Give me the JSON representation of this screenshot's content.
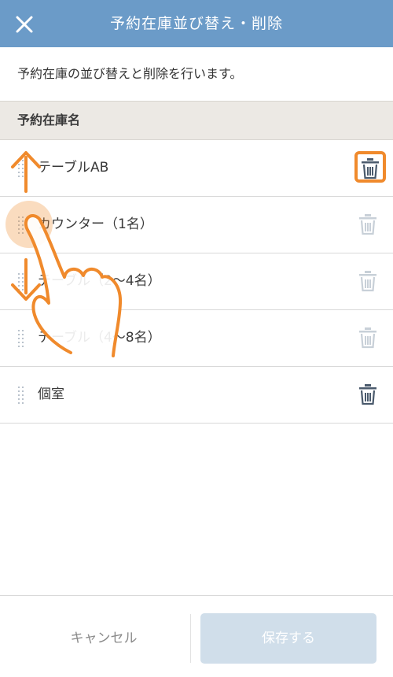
{
  "header": {
    "title": "予約在庫並び替え・削除",
    "close_icon": "close-icon",
    "background": "#6b9bc8"
  },
  "description": "予約在庫の並び替えと削除を行います。",
  "section": {
    "title": "予約在庫名"
  },
  "items": [
    {
      "label": "テーブルAB",
      "delete_enabled": true,
      "delete_highlighted": true
    },
    {
      "label": "カウンター（1名）",
      "delete_enabled": false
    },
    {
      "label": "テーブル（2〜4名）",
      "delete_enabled": false
    },
    {
      "label": "テーブル（4〜8名）",
      "delete_enabled": false
    },
    {
      "label": "個室",
      "delete_enabled": true
    }
  ],
  "footer": {
    "cancel_label": "キャンセル",
    "save_label": "保存する"
  },
  "colors": {
    "accent_orange": "#f08a2c",
    "trash_active": "#4a5a6c",
    "trash_disabled": "#c8d0d8",
    "save_disabled_bg": "#d0deea"
  },
  "gesture_overlay": {
    "icon": "drag-hand-gesture-icon"
  }
}
